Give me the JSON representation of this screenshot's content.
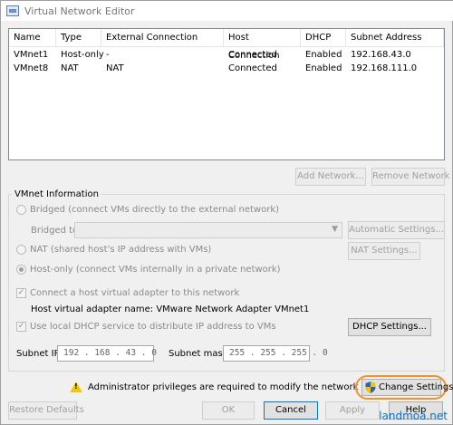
{
  "window": {
    "title": "Virtual Network Editor",
    "icon": "vmware-network-icon"
  },
  "table": {
    "columns": [
      "Name",
      "Type",
      "External Connection",
      "Host Connection",
      "DHCP",
      "Subnet Address"
    ],
    "rows": [
      [
        "VMnet1",
        "Host-only",
        "-",
        "Connected",
        "Enabled",
        "192.168.43.0"
      ],
      [
        "VMnet8",
        "NAT",
        "NAT",
        "Connected",
        "Enabled",
        "192.168.111.0"
      ]
    ]
  },
  "list_buttons": {
    "add_network": "Add Network...",
    "remove_network": "Remove Network"
  },
  "vmnet_info": {
    "group_label": "VMnet Information",
    "bridged_label": "Bridged (connect VMs directly to the external network)",
    "bridged_to_label": "Bridged to:",
    "automatic_settings": "Automatic Settings...",
    "nat_label": "NAT (shared host's IP address with VMs)",
    "nat_settings": "NAT Settings...",
    "hostonly_label": "Host-only (connect VMs internally in a private network)",
    "selected_mode": "host-only",
    "connect_adapter_label": "Connect a host virtual adapter to this network",
    "connect_adapter_checked": true,
    "adapter_name_label": "Host virtual adapter name: VMware Network Adapter VMnet1",
    "dhcp_label": "Use local DHCP service to distribute IP address to VMs",
    "dhcp_checked": true,
    "dhcp_settings": "DHCP Settings...",
    "subnet_ip_label": "Subnet IP:",
    "subnet_ip": "192 . 168 . 43 . 0",
    "subnet_mask_label": "Subnet mask:",
    "subnet_mask": "255 . 255 . 255 . 0"
  },
  "admin_notice": "Administrator privileges are required to modify the network configuration.",
  "change_settings": "Change Settings",
  "footer_buttons": {
    "restore_defaults": "Restore Defaults",
    "ok": "OK",
    "cancel": "Cancel",
    "apply": "Apply",
    "help": "Help"
  },
  "watermark": "landmoa.net",
  "colors": {
    "highlight_ring": "#f0932b",
    "warning": "#f2c800",
    "shield_blue": "#2a62b8",
    "shield_yellow": "#f5c400"
  }
}
